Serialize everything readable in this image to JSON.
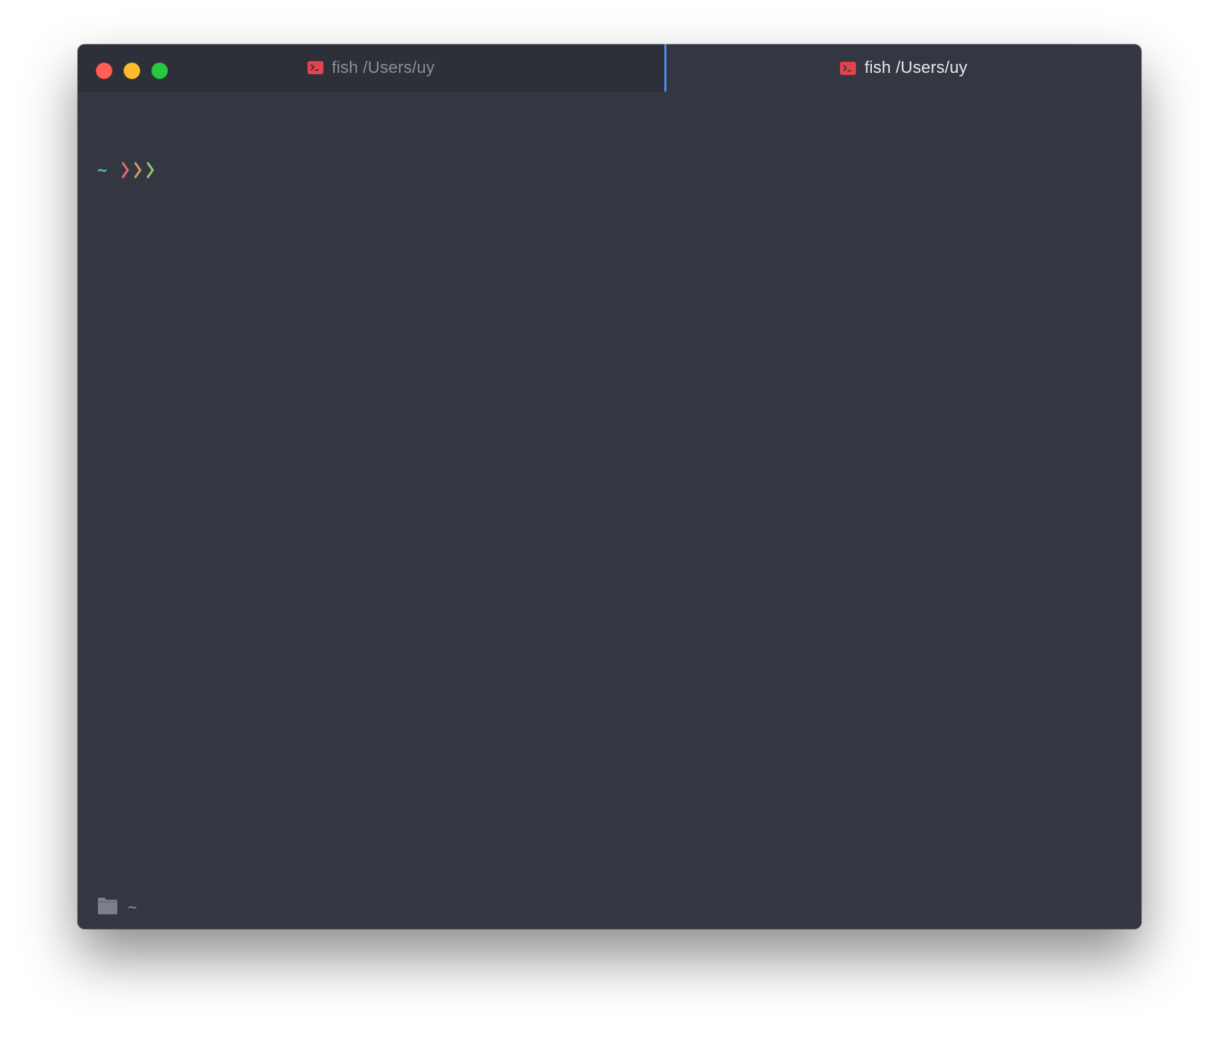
{
  "window": {
    "controls": [
      "close",
      "minimize",
      "zoom"
    ],
    "colors": {
      "background": "#343741",
      "inactive_tab": "#2d3039",
      "active_tab_indicator": "#4f8cf5",
      "terminal_icon": "#e2434d"
    }
  },
  "tabs": [
    {
      "label": "fish /Users/uy",
      "icon": "terminal-icon",
      "active": false
    },
    {
      "label": "fish /Users/uy",
      "icon": "terminal-icon",
      "active": true
    }
  ],
  "terminal": {
    "prompt": {
      "path": "~",
      "chevron_colors": [
        "#e06c75",
        "#d19a66",
        "#98c379"
      ]
    }
  },
  "statusbar": {
    "icon": "folder-icon",
    "path": "~"
  }
}
